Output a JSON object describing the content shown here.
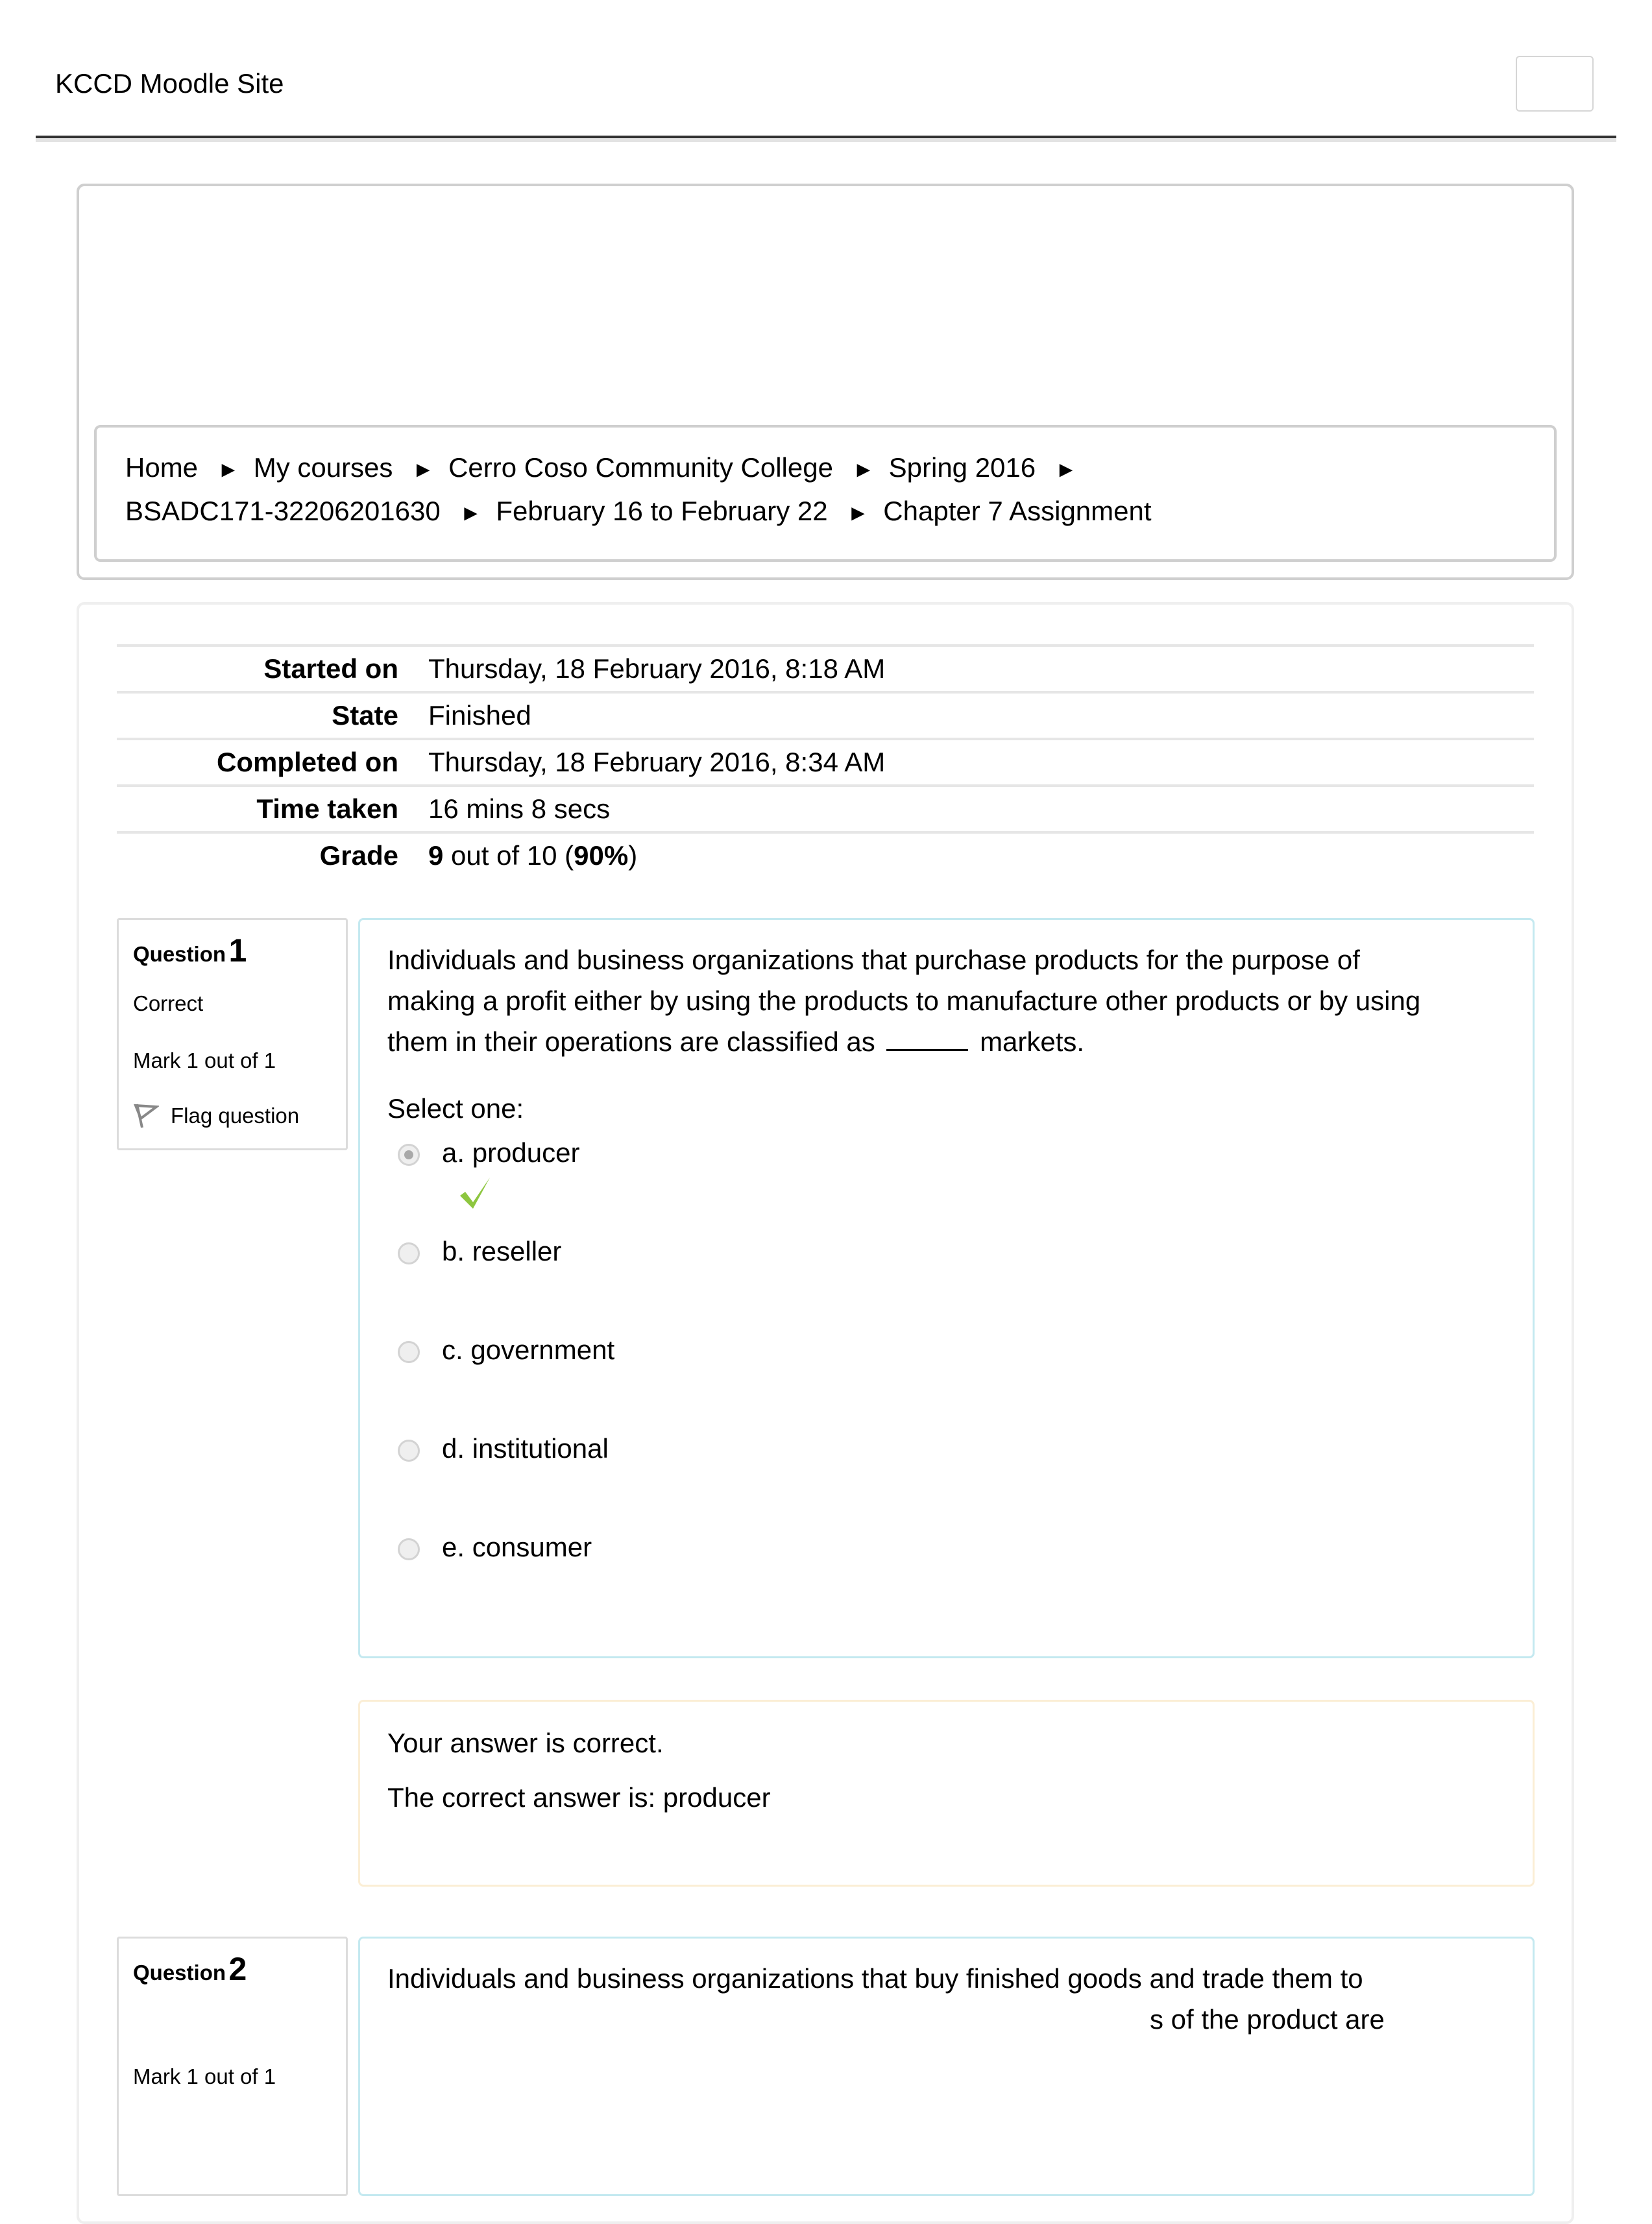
{
  "header": {
    "site_title": "KCCD Moodle Site"
  },
  "breadcrumb": {
    "items": [
      "Home",
      "My courses",
      "Cerro Coso Community College",
      "Spring 2016",
      "BSADC171-32206201630",
      "February 16 to February 22",
      "Chapter 7 Assignment"
    ],
    "separator": "►"
  },
  "summary": {
    "rows": [
      {
        "label": "Started on",
        "value": "Thursday, 18 February 2016, 8:18 AM"
      },
      {
        "label": "State",
        "value": "Finished"
      },
      {
        "label": "Completed on",
        "value": "Thursday, 18 February 2016, 8:34 AM"
      },
      {
        "label": "Time taken",
        "value": "16 mins 8 secs"
      }
    ],
    "grade": {
      "label": "Grade",
      "score": "9",
      "middle": " out of 10 (",
      "percent": "90%",
      "end": ")"
    }
  },
  "questions": [
    {
      "title": "Question",
      "number": "1",
      "state": "Correct",
      "mark": "Mark 1 out of 1",
      "flag_label": "Flag question",
      "text_before_blank": "Individuals and business organizations that purchase products for the purpose of making a profit either by using the products to manufacture other products or by using them in their operations are classified as",
      "text_after_blank": "markets.",
      "prompt": "Select one:",
      "options": [
        {
          "label": "a. producer",
          "selected": true,
          "correct": true
        },
        {
          "label": "b. reseller",
          "selected": false
        },
        {
          "label": "c. government",
          "selected": false
        },
        {
          "label": "d. institutional",
          "selected": false
        },
        {
          "label": "e. consumer",
          "selected": false
        }
      ],
      "feedback": {
        "result": "Your answer is correct.",
        "correct_answer": "The correct answer is: producer"
      }
    },
    {
      "title": "Question",
      "number": "2",
      "mark": "Mark 1 out of 1",
      "text_line1": "Individuals and business organizations that buy finished goods and trade them to",
      "text_line2_fragment": "s of the product are"
    }
  ],
  "colors": {
    "correct_check": "#8dc63f",
    "question_border": "#c4e9f0",
    "feedback_border": "#fbeed5"
  }
}
